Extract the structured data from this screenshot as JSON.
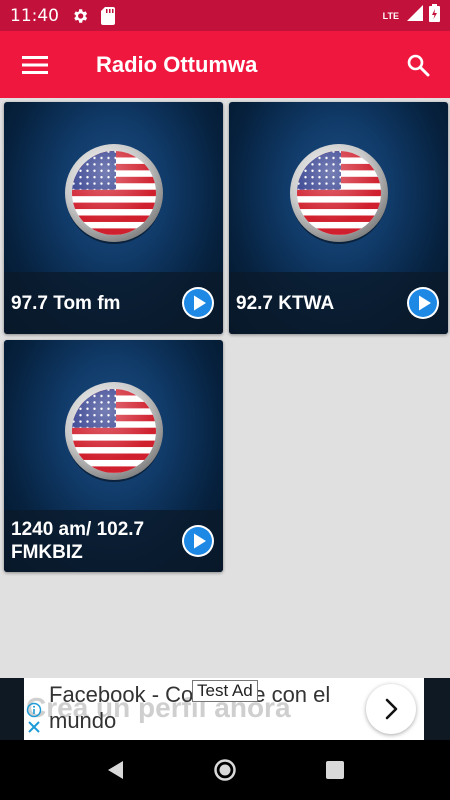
{
  "status_bar": {
    "time": "11:40",
    "network": "LTE",
    "icons": [
      "settings-icon",
      "sd-card-icon",
      "signal-icon",
      "battery-charging-icon"
    ]
  },
  "app_bar": {
    "title": "Radio Ottumwa",
    "menu_icon": "hamburger-menu-icon",
    "search_icon": "search-icon"
  },
  "stations": [
    {
      "name": "97.7 Tom fm",
      "image": "usa-flag-icon",
      "action_icon": "play-icon"
    },
    {
      "name": "92.7 KTWA",
      "image": "usa-flag-icon",
      "action_icon": "play-icon"
    },
    {
      "name": "1240 am/ 102.7 FMKBIZ",
      "image": "usa-flag-icon",
      "action_icon": "play-icon"
    }
  ],
  "ad": {
    "badge": "Test Ad",
    "text": "Facebook - Conéctate con el mundo",
    "background_text": "Crea un perfil ahora",
    "icons": [
      "adchoices-info-icon",
      "close-x-icon",
      "chevron-right-icon"
    ]
  },
  "nav_bar": {
    "icons": [
      "back-icon",
      "home-icon",
      "recents-icon"
    ]
  },
  "colors": {
    "status_bar": "#c2113a",
    "app_bar": "#f0173f",
    "background": "#e0e0e0",
    "play_button": "#1e88e5"
  }
}
